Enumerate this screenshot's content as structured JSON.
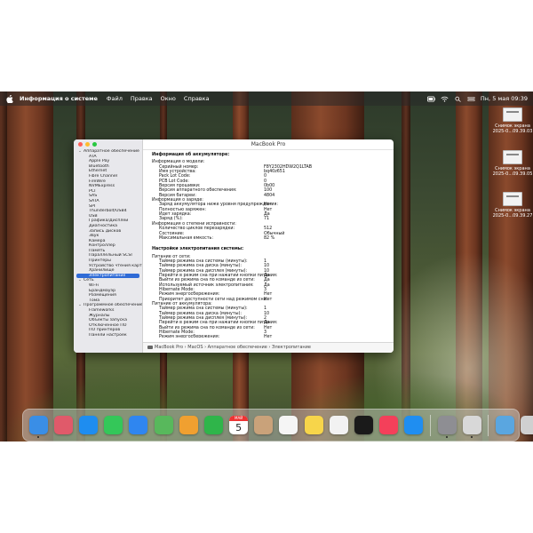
{
  "menubar": {
    "app_name": "Информация о системе",
    "items": [
      "Файл",
      "Правка",
      "Окно",
      "Справка"
    ],
    "clock": "Пн, 5 мая  09:39"
  },
  "desktop": {
    "icons": [
      {
        "line1": "Снимок экрана",
        "line2": "2025-0...09.39.03"
      },
      {
        "line1": "Снимок экрана",
        "line2": "2025-0...09.39.05"
      },
      {
        "line1": "Снимок экрана",
        "line2": "2025-0...09.39.27"
      }
    ]
  },
  "window": {
    "title": "MacBook Pro",
    "sidebar": [
      {
        "label": "Аппаратное обеспечение",
        "level": 0,
        "caret": "⌄"
      },
      {
        "label": "ATA",
        "level": 1
      },
      {
        "label": "Apple Pay",
        "level": 1
      },
      {
        "label": "Bluetooth",
        "level": 1
      },
      {
        "label": "Ethernet",
        "level": 1
      },
      {
        "label": "Fibre Channel",
        "level": 1
      },
      {
        "label": "FireWire",
        "level": 1
      },
      {
        "label": "NVMExpress",
        "level": 1
      },
      {
        "label": "PCI",
        "level": 1
      },
      {
        "label": "SAS",
        "level": 1
      },
      {
        "label": "SATA",
        "level": 1
      },
      {
        "label": "SPI",
        "level": 1
      },
      {
        "label": "Thunderbolt/USB4",
        "level": 1
      },
      {
        "label": "USB",
        "level": 1
      },
      {
        "label": "Графика/Дисплеи",
        "level": 1
      },
      {
        "label": "Диагностика",
        "level": 1
      },
      {
        "label": "Запись дисков",
        "level": 1
      },
      {
        "label": "Звук",
        "level": 1
      },
      {
        "label": "Камера",
        "level": 1
      },
      {
        "label": "Контроллер",
        "level": 1
      },
      {
        "label": "Память",
        "level": 1
      },
      {
        "label": "Параллельный SCSI",
        "level": 1
      },
      {
        "label": "Принтеры",
        "level": 1
      },
      {
        "label": "Устройство чтения карт",
        "level": 1
      },
      {
        "label": "Хранилище",
        "level": 1
      },
      {
        "label": "Электропитание",
        "level": 1,
        "selected": true
      },
      {
        "label": "Сеть",
        "level": 0,
        "caret": "⌄"
      },
      {
        "label": "Wi-Fi",
        "level": 1
      },
      {
        "label": "Брандмауэр",
        "level": 1
      },
      {
        "label": "Размещения",
        "level": 1
      },
      {
        "label": "Тома",
        "level": 1
      },
      {
        "label": "Программное обеспечение",
        "level": 0,
        "caret": "⌄"
      },
      {
        "label": "Frameworks",
        "level": 1
      },
      {
        "label": "Журналы",
        "level": 1
      },
      {
        "label": "Объекты запуска",
        "level": 1
      },
      {
        "label": "Отключенное ПО",
        "level": 1
      },
      {
        "label": "ПО принтеров",
        "level": 1
      },
      {
        "label": "Панели настроек",
        "level": 1
      }
    ],
    "sections": [
      {
        "title": "Информация об аккумуляторе:",
        "rows": [
          {
            "k": "Информация о модели:",
            "v": "",
            "indent": 1
          },
          {
            "k": "Серийный номер:",
            "v": "F8Y2302HDW2Q1LTAB",
            "indent": 3
          },
          {
            "k": "Имя устройства:",
            "v": "bq40z651",
            "indent": 3
          },
          {
            "k": "Pack Lot Code:",
            "v": "0",
            "indent": 3
          },
          {
            "k": "PCB Lot Code:",
            "v": "0",
            "indent": 3
          },
          {
            "k": "Версия прошивки:",
            "v": "0b00",
            "indent": 3
          },
          {
            "k": "Версия аппаратного обеспечения:",
            "v": "100",
            "indent": 3
          },
          {
            "k": "Версия батареи:",
            "v": "4804",
            "indent": 3
          },
          {
            "k": "Информация о заряде:",
            "v": "",
            "indent": 1
          },
          {
            "k": "Заряд аккумулятора ниже уровня предупреждения:",
            "v": "Нет",
            "indent": 3
          },
          {
            "k": "Полностью заряжен:",
            "v": "Нет",
            "indent": 3
          },
          {
            "k": "Идет зарядка:",
            "v": "Да",
            "indent": 3
          },
          {
            "k": "Заряд (%):",
            "v": "71",
            "indent": 3
          },
          {
            "k": "Информация о степени исправности:",
            "v": "",
            "indent": 1
          },
          {
            "k": "Количество циклов перезарядки:",
            "v": "512",
            "indent": 3
          },
          {
            "k": "Состояние:",
            "v": "Обычный",
            "indent": 3
          },
          {
            "k": "Максимальная емкость:",
            "v": "82 %",
            "indent": 3
          }
        ]
      },
      {
        "title": "Настройки электропитания системы:",
        "rows": [
          {
            "k": "Питание от сети:",
            "v": "",
            "indent": 1
          },
          {
            "k": "Таймер режима сна системы (минуты):",
            "v": "1",
            "indent": 3
          },
          {
            "k": "Таймер режима сна диска (минуты):",
            "v": "10",
            "indent": 3
          },
          {
            "k": "Таймер режима сна дисплея (минуты):",
            "v": "10",
            "indent": 3
          },
          {
            "k": "Перейти в режим сна при нажатии кнопки питания:",
            "v": "Да",
            "indent": 3
          },
          {
            "k": "Выйти из режима сна по команде из сети:",
            "v": "Да",
            "indent": 3
          },
          {
            "k": "Используемый источник электропитания:",
            "v": "Да",
            "indent": 3
          },
          {
            "k": "Hibernate Mode:",
            "v": "3",
            "indent": 3
          },
          {
            "k": "Режим энергосбережения:",
            "v": "Нет",
            "indent": 3
          },
          {
            "k": "Приоритет доступности сети над режимом сна:",
            "v": "Нет",
            "indent": 3
          },
          {
            "k": "Питание от аккумулятора:",
            "v": "",
            "indent": 1
          },
          {
            "k": "Таймер режима сна системы (минуты):",
            "v": "1",
            "indent": 3
          },
          {
            "k": "Таймер режима сна диска (минуты):",
            "v": "10",
            "indent": 3
          },
          {
            "k": "Таймер режима сна дисплея (минуты):",
            "v": "2",
            "indent": 3
          },
          {
            "k": "Перейти в режим сна при нажатии кнопки питания:",
            "v": "Да",
            "indent": 3
          },
          {
            "k": "Выйти из режима сна по команде из сети:",
            "v": "Нет",
            "indent": 3
          },
          {
            "k": "Hibernate Mode:",
            "v": "3",
            "indent": 3
          },
          {
            "k": "Режим энергосбережения:",
            "v": "Нет",
            "indent": 3
          }
        ]
      }
    ],
    "pathbar": "MacBook Pro  ›  MacOS  ›  Аппаратное обеспечение  ›  Электропитание"
  },
  "dock": {
    "calendar_month": "МАЙ",
    "calendar_day": "5",
    "apps": [
      {
        "name": "finder-icon",
        "color": "#3a8ee6",
        "running": true
      },
      {
        "name": "launchpad-icon",
        "color": "#e05a6a"
      },
      {
        "name": "safari-icon",
        "color": "#1e8df0"
      },
      {
        "name": "messages-icon",
        "color": "#34c759"
      },
      {
        "name": "mail-icon",
        "color": "#2f86f0"
      },
      {
        "name": "maps-icon",
        "color": "#58b85c"
      },
      {
        "name": "photos-icon",
        "color": "#f0a030"
      },
      {
        "name": "facetime-icon",
        "color": "#2fb54a"
      },
      {
        "name": "calendar-icon",
        "color": "#ffffff"
      },
      {
        "name": "contacts-icon",
        "color": "#c9a27a"
      },
      {
        "name": "reminders-icon",
        "color": "#f5f5f5"
      },
      {
        "name": "notes-icon",
        "color": "#f7d54a"
      },
      {
        "name": "freeform-icon",
        "color": "#f2f2f2"
      },
      {
        "name": "tv-icon",
        "color": "#1a1a1a"
      },
      {
        "name": "music-icon",
        "color": "#f4405a"
      },
      {
        "name": "app-store-icon",
        "color": "#1f8ef1"
      },
      {
        "name": "system-settings-icon",
        "color": "#8e8e93",
        "running": true
      },
      {
        "name": "system-information-icon",
        "color": "#d8d8d8",
        "running": true
      },
      {
        "name": "downloads-folder-icon",
        "color": "#5aa6e0"
      },
      {
        "name": "trash-icon",
        "color": "#d0d0d0"
      }
    ]
  }
}
